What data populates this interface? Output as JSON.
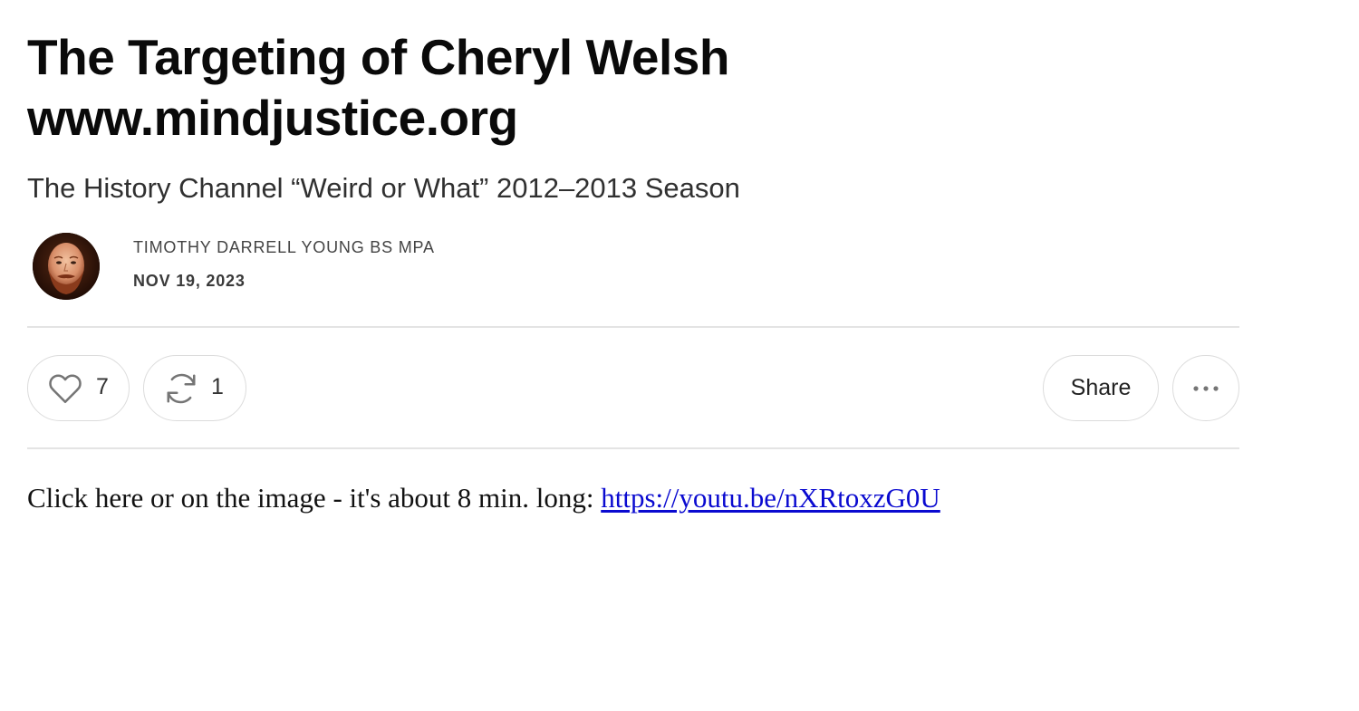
{
  "post": {
    "title": "The Targeting of Cheryl Welsh www.mindjustice.org",
    "subtitle": "The History Channel “Weird or What” 2012–2013 Season",
    "author": "TIMOTHY DARRELL YOUNG BS MPA",
    "date": "NOV 19, 2023"
  },
  "actions": {
    "like_icon": "heart-icon",
    "like_count": "7",
    "restack_icon": "restack-icon",
    "restack_count": "1",
    "share_label": "Share",
    "more_icon": "ellipsis-icon"
  },
  "body": {
    "text": "Click here or on the image - it's about 8 min. long: ",
    "link_text": "https://youtu.be/nXRtoxzG0U",
    "link_url": "https://youtu.be/nXRtoxzG0U"
  },
  "colors": {
    "link": "#0a0ad0",
    "divider": "#e4e4e4",
    "pill_border": "#dcdcdc"
  }
}
